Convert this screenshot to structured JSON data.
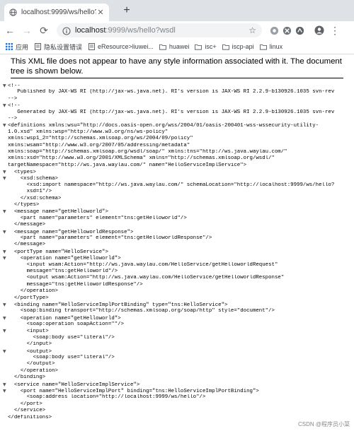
{
  "tab": {
    "title": "localhost:9999/ws/hello?wsdl",
    "close_glyph": "✕",
    "new_tab_glyph": "+"
  },
  "toolbar": {
    "back_glyph": "←",
    "forward_glyph": "→",
    "reload_glyph": "⟳",
    "url_host": "localhost",
    "url_path": ":9999/ws/hello?wsdl",
    "star_glyph": "☆",
    "menu_glyph": "⋮"
  },
  "bookmarks": [
    {
      "label": "应用",
      "icon": "apps-grid-icon"
    },
    {
      "label": "隐私设置错误",
      "icon": "page-icon"
    },
    {
      "label": "eResource>liuwei...",
      "icon": "page-icon"
    },
    {
      "label": "huawei",
      "icon": "folder-icon"
    },
    {
      "label": "isc+",
      "icon": "folder-icon"
    },
    {
      "label": "iscp-api",
      "icon": "folder-icon"
    },
    {
      "label": "linux",
      "icon": "folder-icon"
    }
  ],
  "notice": "This XML file does not appear to have any style information associated with it. The document tree is shown below.",
  "xml_lines": [
    {
      "t": "▼",
      "text": "<!--"
    },
    {
      "t": "",
      "text": "   Published by JAX-WS RI (http://jax-ws.java.net). RI's version is JAX-WS RI 2.2.9-b130926.1035 svn-rev"
    },
    {
      "t": "",
      "text": "-->"
    },
    {
      "t": "▼",
      "text": "<!--"
    },
    {
      "t": "",
      "text": "   Generated by JAX-WS RI (http://jax-ws.java.net). RI's version is JAX-WS RI 2.2.9-b130926.1035 svn-rev"
    },
    {
      "t": "",
      "text": "-->"
    },
    {
      "t": "▼",
      "text": "<definitions xmlns:wsu=\"http://docs.oasis-open.org/wss/2004/01/oasis-200401-wss-wssecurity-utility-"
    },
    {
      "t": "",
      "text": "1.0.xsd\" xmlns:wsp=\"http://www.w3.org/ns/ws-policy\""
    },
    {
      "t": "",
      "text": "xmlns:wsp1_2=\"http://schemas.xmlsoap.org/ws/2004/09/policy\""
    },
    {
      "t": "",
      "text": "xmlns:wsam=\"http://www.w3.org/2007/05/addressing/metadata\""
    },
    {
      "t": "",
      "text": "xmlns:soap=\"http://schemas.xmlsoap.org/wsdl/soap/\" xmlns:tns=\"http://ws.java.waylau.com/\""
    },
    {
      "t": "",
      "text": "xmlns:xsd=\"http://www.w3.org/2001/XMLSchema\" xmlns=\"http://schemas.xmlsoap.org/wsdl/\""
    },
    {
      "t": "",
      "text": "targetNamespace=\"http://ws.java.waylau.com/\" name=\"HelloServiceImplService\">"
    },
    {
      "t": "▼",
      "text": "  <types>"
    },
    {
      "t": "▼",
      "text": "    <xsd:schema>"
    },
    {
      "t": "",
      "text": "      <xsd:import namespace=\"http://ws.java.waylau.com/\" schemaLocation=\"http://localhost:9999/ws/hello?"
    },
    {
      "t": "",
      "text": "      xsd=1\"/>"
    },
    {
      "t": "",
      "text": "    </xsd:schema>"
    },
    {
      "t": "",
      "text": "  </types>"
    },
    {
      "t": "▼",
      "text": "  <message name=\"getHelloworld\">"
    },
    {
      "t": "",
      "text": "    <part name=\"parameters\" element=\"tns:getHelloworld\"/>"
    },
    {
      "t": "",
      "text": "  </message>"
    },
    {
      "t": "▼",
      "text": "  <message name=\"getHelloworldResponse\">"
    },
    {
      "t": "",
      "text": "    <part name=\"parameters\" element=\"tns:getHelloworldResponse\"/>"
    },
    {
      "t": "",
      "text": "  </message>"
    },
    {
      "t": "▼",
      "text": "  <portType name=\"HelloService\">"
    },
    {
      "t": "▼",
      "text": "    <operation name=\"getHelloworld\">"
    },
    {
      "t": "",
      "text": "      <input wsam:Action=\"http://ws.java.waylau.com/HelloService/getHelloworldRequest\""
    },
    {
      "t": "",
      "text": "      message=\"tns:getHelloworld\"/>"
    },
    {
      "t": "",
      "text": "      <output wsam:Action=\"http://ws.java.waylau.com/HelloService/getHelloworldResponse\""
    },
    {
      "t": "",
      "text": "      message=\"tns:getHelloworldResponse\"/>"
    },
    {
      "t": "",
      "text": "    </operation>"
    },
    {
      "t": "",
      "text": "  </portType>"
    },
    {
      "t": "▼",
      "text": "  <binding name=\"HelloServiceImplPortBinding\" type=\"tns:HelloService\">"
    },
    {
      "t": "",
      "text": "    <soap:binding transport=\"http://schemas.xmlsoap.org/soap/http\" style=\"document\"/>"
    },
    {
      "t": "▼",
      "text": "    <operation name=\"getHelloworld\">"
    },
    {
      "t": "",
      "text": "      <soap:operation soapAction=\"\"/>"
    },
    {
      "t": "▼",
      "text": "      <input>"
    },
    {
      "t": "",
      "text": "        <soap:body use=\"literal\"/>"
    },
    {
      "t": "",
      "text": "      </input>"
    },
    {
      "t": "▼",
      "text": "      <output>"
    },
    {
      "t": "",
      "text": "        <soap:body use=\"literal\"/>"
    },
    {
      "t": "",
      "text": "      </output>"
    },
    {
      "t": "",
      "text": "    </operation>"
    },
    {
      "t": "",
      "text": "  </binding>"
    },
    {
      "t": "▼",
      "text": "  <service name=\"HelloServiceImplService\">"
    },
    {
      "t": "▼",
      "text": "    <port name=\"HelloServiceImplPort\" binding=\"tns:HelloServiceImplPortBinding\">"
    },
    {
      "t": "",
      "text": "      <soap:address location=\"http://localhost:9999/ws/hello\"/>"
    },
    {
      "t": "",
      "text": "    </port>"
    },
    {
      "t": "",
      "text": "  </service>"
    },
    {
      "t": "",
      "text": "</definitions>"
    }
  ],
  "watermark": "CSDN @程序员小菜",
  "colors": {
    "tabstrip": "#dee1e6",
    "omnibox": "#f1f3f4",
    "avatar": "#5f6368"
  }
}
